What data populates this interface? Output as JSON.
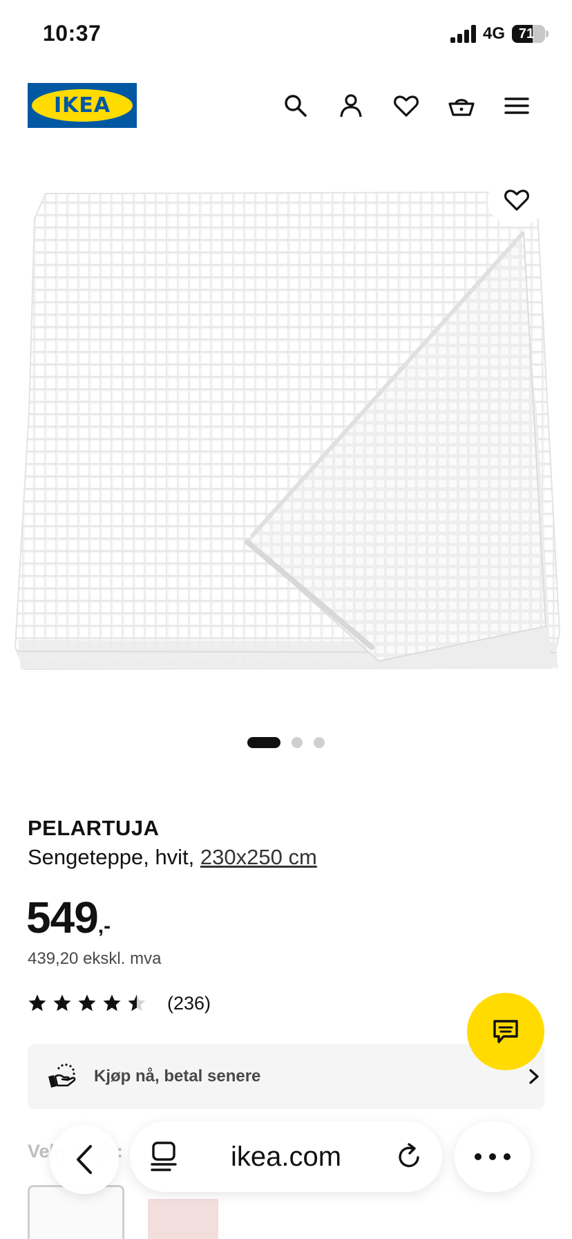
{
  "status_bar": {
    "time": "10:37",
    "network": "4G",
    "battery": "71",
    "battery_level": 0.71
  },
  "header": {
    "logo_text": "IKEA",
    "icons": [
      "search-icon",
      "user-icon",
      "heart-icon",
      "basket-icon",
      "menu-icon"
    ]
  },
  "gallery": {
    "slide_count": 3,
    "active_slide": 1,
    "favorite_icon": "heart-icon"
  },
  "product": {
    "name": "PELARTUJA",
    "description": "Sengeteppe, hvit, ",
    "size": "230x250 cm",
    "price": "549",
    "price_suffix": ",-",
    "price_ex_vat": "439,20 ekskl. mva",
    "rating": 4.5,
    "rating_max": 5,
    "review_count": "(236)"
  },
  "pay_later": {
    "label": "Kjøp nå, betal senere"
  },
  "variants": {
    "label": "Velg farge:"
  },
  "browser": {
    "url": "ikea.com"
  },
  "colors": {
    "ikea_blue": "#0058a3",
    "ikea_yellow": "#ffdb00",
    "text": "#111111",
    "muted": "#484848"
  }
}
